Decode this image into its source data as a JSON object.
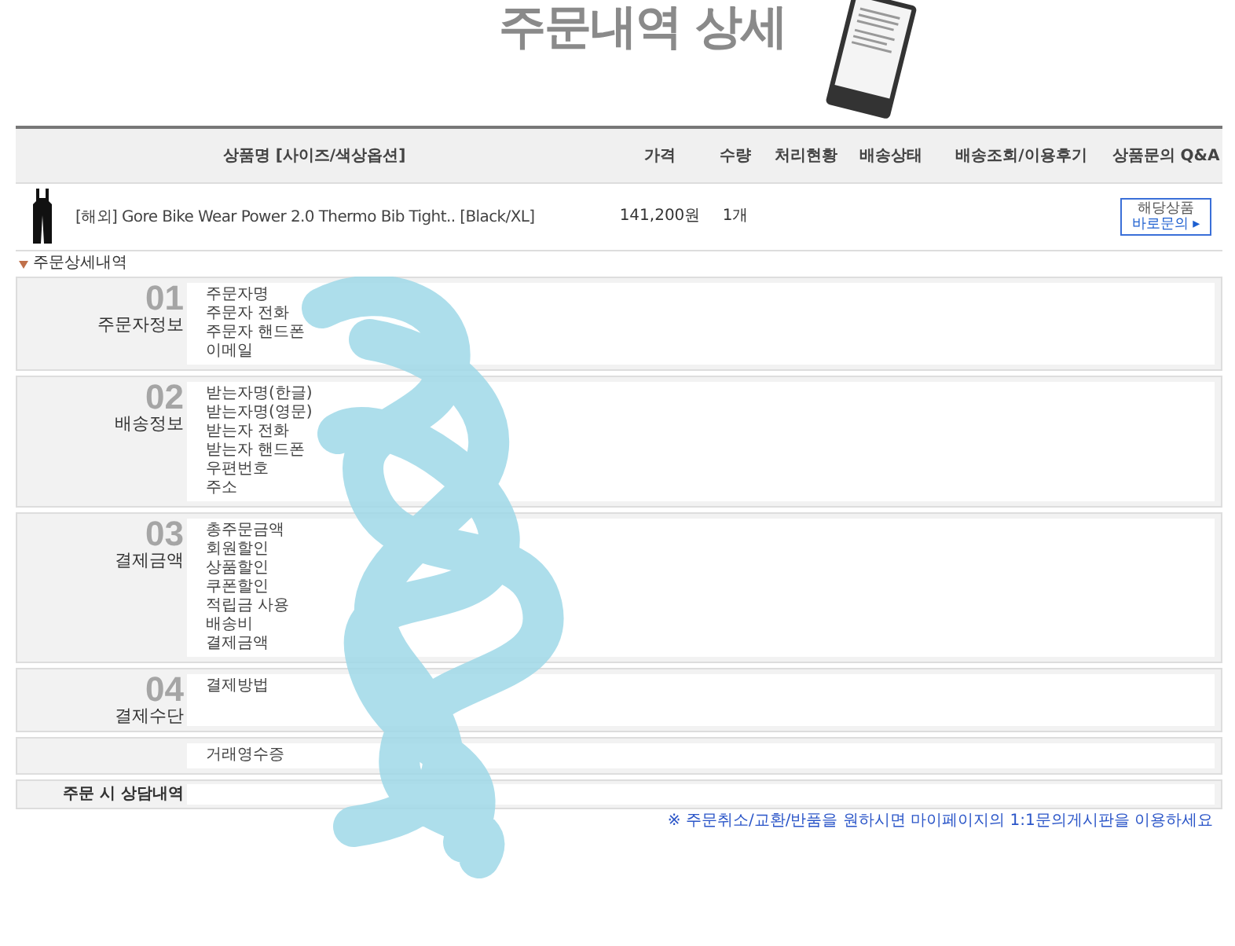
{
  "page_title": "주문내역 상세",
  "table": {
    "columns": [
      "상품명 [사이즈/색상옵션]",
      "가격",
      "수량",
      "처리현황",
      "배송상태",
      "배송조회/이용후기",
      "상품문의 Q&A"
    ],
    "rows": [
      {
        "name": "[해외] Gore Bike Wear Power 2.0 Thermo Bib Tight.. [Black/XL]",
        "price": "141,200원",
        "quantity": "1개",
        "qa_button": [
          "해당상품",
          "바로문의 ▸"
        ]
      }
    ]
  },
  "detail_heading": "주문상세내역",
  "sections": [
    {
      "kind": "numbered",
      "number": "01",
      "title": "주문자정보",
      "labels": [
        "주문자명",
        "주문자 전화",
        "주문자 핸드폰",
        "이메일"
      ]
    },
    {
      "kind": "numbered",
      "number": "02",
      "title": "배송정보",
      "labels": [
        "받는자명(한글)",
        "받는자명(영문)",
        "받는자 전화",
        "받는자 핸드폰",
        "우편번호",
        "주소"
      ]
    },
    {
      "kind": "numbered",
      "number": "03",
      "title": "결제금액",
      "labels": [
        "총주문금액",
        "회원할인",
        "상품할인",
        "쿠폰할인",
        "적립금 사용",
        "배송비",
        "결제금액"
      ]
    },
    {
      "kind": "numbered",
      "number": "04",
      "title": "결제수단",
      "labels": [
        "결제방법"
      ]
    },
    {
      "kind": "plain",
      "labels": [
        "거래영수증"
      ]
    },
    {
      "kind": "heading",
      "title": "주문 시 상담내역"
    }
  ],
  "footer_note": "※ 주문취소/교환/반품을 원하시면 마이페이지의 1:1문의게시판을 이용하세요"
}
